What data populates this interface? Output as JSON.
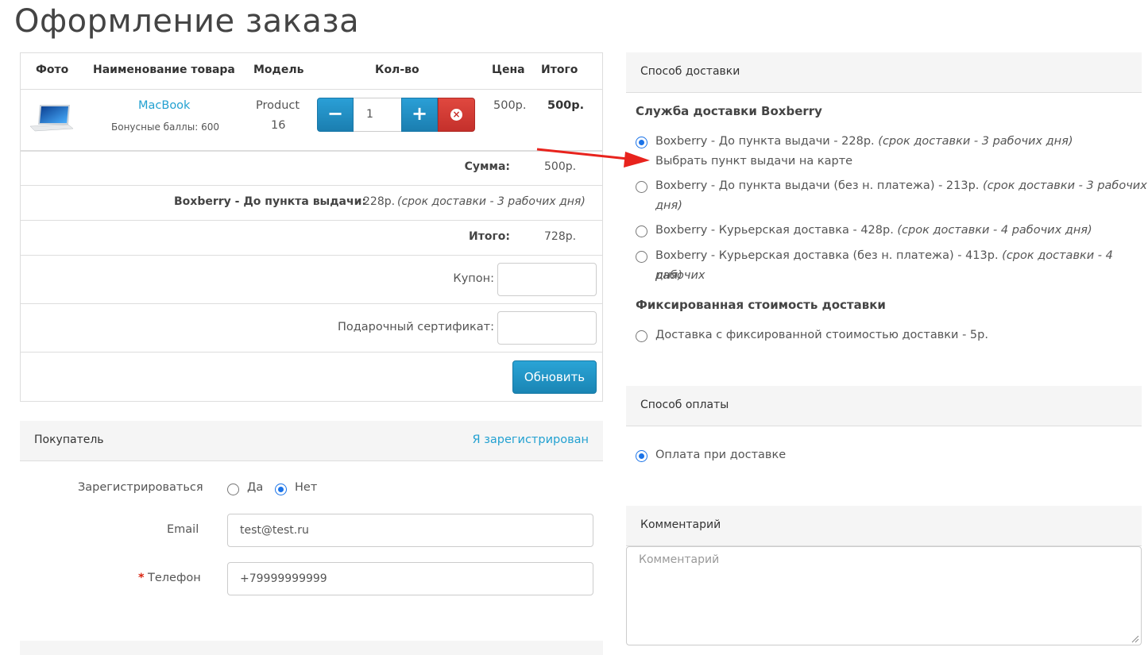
{
  "page_title": "Оформление заказа",
  "cart": {
    "headers": {
      "photo": "Фото",
      "name": "Наименование товара",
      "model": "Модель",
      "qty": "Кол-во",
      "price": "Цена",
      "total": "Итого"
    },
    "item": {
      "name": "MacBook",
      "bonus": "Бонусные баллы: 600",
      "model_line1": "Product",
      "model_line2": "16",
      "qty": "1",
      "minus": "−",
      "plus": "+",
      "remove": "×",
      "price": "500р.",
      "total": "500р."
    },
    "subtotal_label": "Сумма:",
    "subtotal_value": "500р.",
    "shipping_label": "Boxberry - До пункта выдачи:",
    "shipping_value": "228р.",
    "shipping_note": "(срок доставки - 3 рабочих дня)",
    "total_label": "Итого:",
    "total_value": "728р.",
    "coupon_label": "Купон:",
    "coupon_value": "",
    "voucher_label": "Подарочный сертификат:",
    "voucher_value": "",
    "update_button": "Обновить"
  },
  "customer": {
    "title": "Покупатель",
    "login_link": "Я зарегистрирован",
    "register_label": "Зарегистрироваться",
    "register_yes": "Да",
    "register_no": "Нет",
    "register_selected": "Нет",
    "email_label": "Email",
    "email_value": "test@test.ru",
    "required_star": "*",
    "phone_label": "Телефон",
    "phone_value": "+79999999999"
  },
  "shipping": {
    "title": "Способ доставки",
    "group1_title": "Служба доставки Boxberry",
    "options": [
      {
        "text": "Boxberry - До пункта выдачи - 228р.",
        "note": "(срок доставки - 3 рабочих дня)",
        "checked": true
      },
      {
        "text": "Boxberry - До пункта выдачи (без н. платежа) - 213р.",
        "note": "(срок доставки - 3 рабочих",
        "note2": "дня)",
        "checked": false
      },
      {
        "text": "Boxberry - Курьерская доставка - 428р.",
        "note": "(срок доставки - 4 рабочих дня)",
        "checked": false
      },
      {
        "text": "Boxberry - Курьерская доставка (без н. платежа) - 413р.",
        "note": "(срок доставки - 4 рабочих",
        "note2": "дня)",
        "checked": false
      }
    ],
    "pickup_link": "Выбрать пункт выдачи на карте",
    "group2_title": "Фиксированная стоимость доставки",
    "fixed_option": "Доставка с фиксированной стоимостью доставки - 5р.",
    "arrow_color": "#e8231d"
  },
  "payment": {
    "title": "Способ оплаты",
    "option": "Оплата при доставке",
    "checked": true
  },
  "comment": {
    "title": "Комментарий",
    "placeholder": "Комментарий"
  },
  "colors": {
    "accent": "#23a1d1",
    "button_blue": "#1b8dc2",
    "button_red": "#d9413a"
  }
}
